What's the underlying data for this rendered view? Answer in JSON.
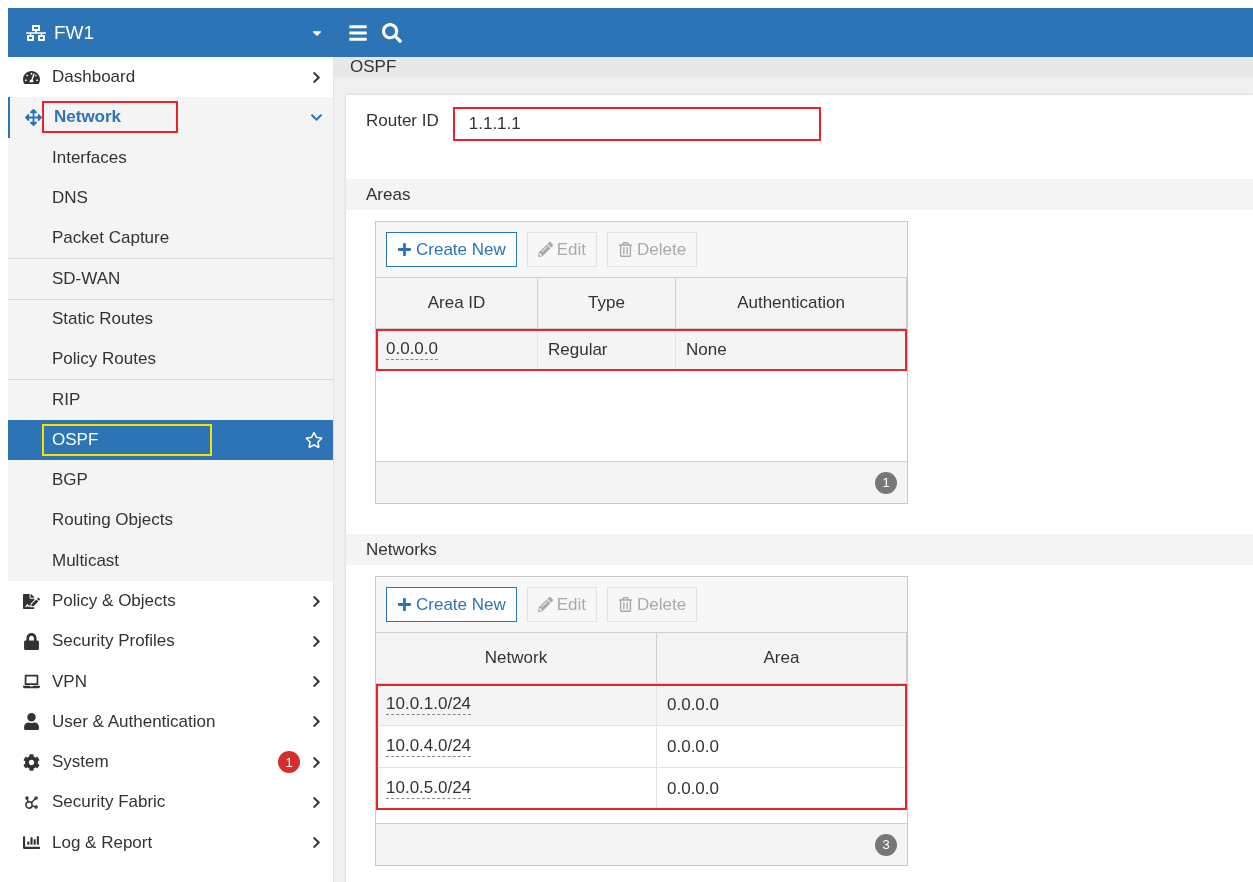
{
  "topbar": {
    "title": "FW1"
  },
  "sidebar": {
    "items": [
      {
        "label": "Dashboard",
        "selected": false,
        "expanded": false
      },
      {
        "label": "Network",
        "selected": false,
        "expanded": true,
        "highlight": {
          "color": "#e8232b"
        },
        "children": [
          {
            "label": "Interfaces",
            "selected": false,
            "group_start": false
          },
          {
            "label": "DNS",
            "selected": false,
            "group_start": false
          },
          {
            "label": "Packet Capture",
            "selected": false,
            "group_start": false
          },
          {
            "label": "SD-WAN",
            "selected": false,
            "group_start": true
          },
          {
            "label": "Static Routes",
            "selected": false,
            "group_start": true
          },
          {
            "label": "Policy Routes",
            "selected": false,
            "group_start": false
          },
          {
            "label": "RIP",
            "selected": false,
            "group_start": true
          },
          {
            "label": "OSPF",
            "selected": true,
            "group_start": false,
            "highlight": {
              "color": "#f5e400"
            }
          },
          {
            "label": "BGP",
            "selected": false,
            "group_start": false
          },
          {
            "label": "Routing Objects",
            "selected": false,
            "group_start": false
          },
          {
            "label": "Multicast",
            "selected": false,
            "group_start": false
          }
        ]
      },
      {
        "label": "Policy & Objects",
        "selected": false,
        "expanded": false
      },
      {
        "label": "Security Profiles",
        "selected": false,
        "expanded": false
      },
      {
        "label": "VPN",
        "selected": false,
        "expanded": false
      },
      {
        "label": "User & Authentication",
        "selected": false,
        "expanded": false
      },
      {
        "label": "System",
        "selected": false,
        "expanded": false,
        "badge": "1"
      },
      {
        "label": "Security Fabric",
        "selected": false,
        "expanded": false
      },
      {
        "label": "Log & Report",
        "selected": false,
        "expanded": false
      }
    ]
  },
  "page": {
    "title": "OSPF",
    "router_id": {
      "label": "Router ID",
      "value": "1.1.1.1",
      "highlight": {
        "color": "#e8232b"
      }
    },
    "sections": [
      {
        "title": "Areas",
        "buttons": [
          {
            "label": "Create New",
            "disabled": false
          },
          {
            "label": "Edit",
            "disabled": true
          },
          {
            "label": "Delete",
            "disabled": true
          }
        ],
        "columns": [
          "Area ID",
          "Type",
          "Authentication"
        ],
        "rows": [
          [
            "0.0.0.0",
            "Regular",
            "None"
          ]
        ],
        "rows_highlight": {
          "color": "#e8232b"
        },
        "count": "1"
      },
      {
        "title": "Networks",
        "buttons": [
          {
            "label": "Create New",
            "disabled": false
          },
          {
            "label": "Edit",
            "disabled": true
          },
          {
            "label": "Delete",
            "disabled": true
          }
        ],
        "columns": [
          "Network",
          "Area"
        ],
        "rows": [
          [
            "10.0.1.0/24",
            "0.0.0.0"
          ],
          [
            "10.0.4.0/24",
            "0.0.0.0"
          ],
          [
            "10.0.5.0/24",
            "0.0.0.0"
          ]
        ],
        "rows_highlight": {
          "color": "#e8232b"
        },
        "count": "3"
      }
    ]
  }
}
